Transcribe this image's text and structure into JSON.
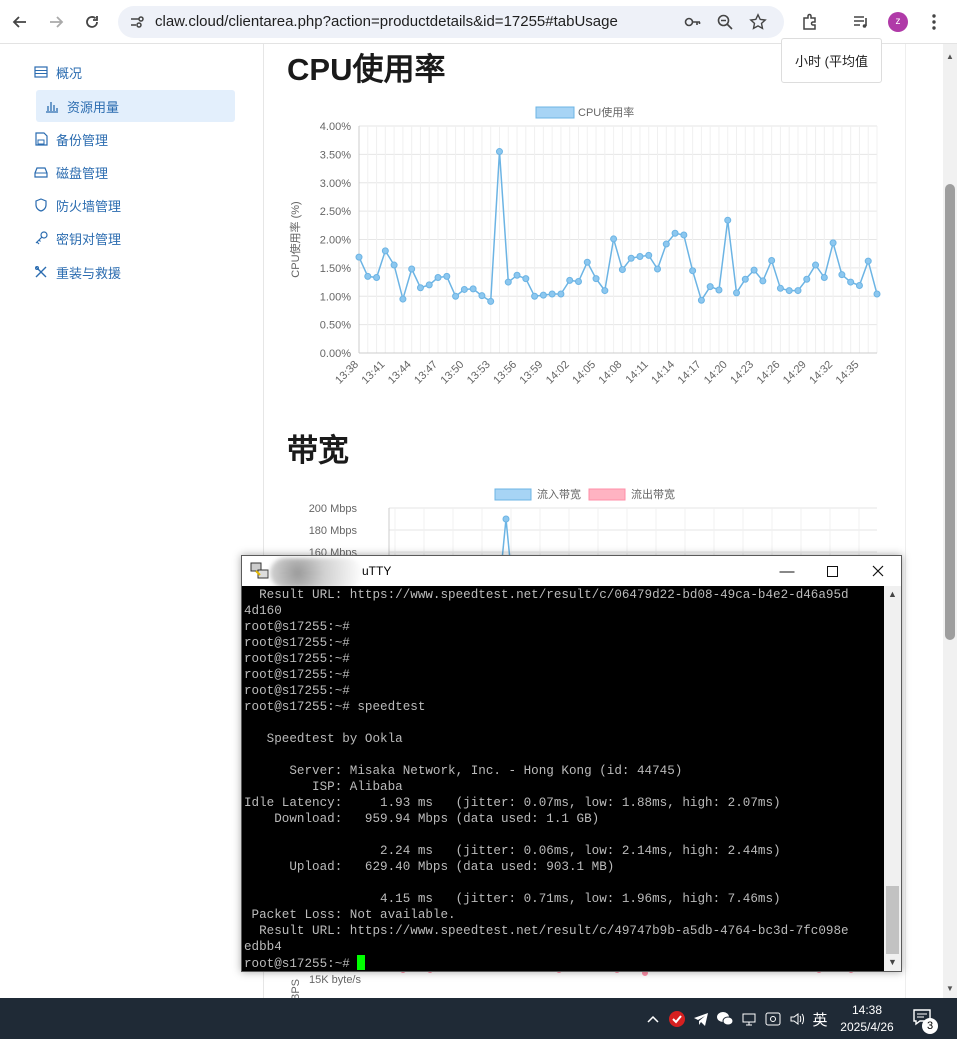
{
  "browser": {
    "url": "claw.cloud/clientarea.php?action=productdetails&id=17255#tabUsage",
    "avatar_letter": "z"
  },
  "sidebar": {
    "items": [
      {
        "label": "概况",
        "icon": "list-icon"
      },
      {
        "label": "资源用量",
        "icon": "bar-chart-icon",
        "active": true
      },
      {
        "label": "备份管理",
        "icon": "save-icon"
      },
      {
        "label": "磁盘管理",
        "icon": "disk-icon"
      },
      {
        "label": "防火墙管理",
        "icon": "shield-icon"
      },
      {
        "label": "密钥对管理",
        "icon": "key-icon"
      },
      {
        "label": "重装与救援",
        "icon": "tools-icon"
      }
    ]
  },
  "main": {
    "cpu_title": "CPU使用率",
    "period_button": "小时 (平均值",
    "bandwidth_title": "带宽"
  },
  "chart_data": [
    {
      "type": "line",
      "legend": [
        "CPU使用率"
      ],
      "ylabel": "CPU使用率 (%)",
      "ylim": [
        0,
        4
      ],
      "yticks": [
        "0.00%",
        "0.50%",
        "1.00%",
        "1.50%",
        "2.00%",
        "2.50%",
        "3.00%",
        "3.50%",
        "4.00%"
      ],
      "xtick_labels": [
        "13:38",
        "13:41",
        "13:44",
        "13:47",
        "13:50",
        "13:53",
        "13:56",
        "13:59",
        "14:02",
        "14:05",
        "14:08",
        "14:11",
        "14:14",
        "14:17",
        "14:20",
        "14:23",
        "14:26",
        "14:29",
        "14:32",
        "14:35"
      ],
      "series": [
        {
          "name": "CPU使用率",
          "color": "#6cb4e4",
          "values": [
            1.69,
            1.35,
            1.33,
            1.8,
            1.55,
            0.95,
            1.48,
            1.15,
            1.2,
            1.33,
            1.35,
            1.0,
            1.12,
            1.13,
            1.01,
            0.91,
            3.55,
            1.25,
            1.37,
            1.31,
            1.0,
            1.02,
            1.04,
            1.04,
            1.28,
            1.26,
            1.6,
            1.31,
            1.1,
            2.01,
            1.47,
            1.67,
            1.7,
            1.72,
            1.48,
            1.92,
            2.11,
            2.08,
            1.45,
            0.93,
            1.17,
            1.11,
            2.34,
            1.06,
            1.3,
            1.46,
            1.27,
            1.63,
            1.14,
            1.1,
            1.1,
            1.3,
            1.55,
            1.33,
            1.94,
            1.38,
            1.25,
            1.19,
            1.62,
            1.04
          ]
        }
      ]
    },
    {
      "type": "line",
      "legend": [
        "流入带宽",
        "流出带宽"
      ],
      "yticks": [
        "200 Mbps",
        "180 Mbps",
        "160 Mbps"
      ],
      "ylim": [
        160,
        200
      ],
      "series": [
        {
          "name": "流入带宽",
          "color": "#6cb4e4",
          "peak": 190
        },
        {
          "name": "流出带宽",
          "color": "#ff8fa8"
        }
      ],
      "second_axis_label": "15K byte/s",
      "second_axis_unit": "BPS"
    }
  ],
  "putty": {
    "title": "uTTY",
    "lines": [
      "  Result URL: https://www.speedtest.net/result/c/06479d22-bd08-49ca-b4e2-d46a95d",
      "4d160",
      "root@s17255:~#",
      "root@s17255:~#",
      "root@s17255:~#",
      "root@s17255:~#",
      "root@s17255:~#",
      "root@s17255:~# speedtest",
      "",
      "   Speedtest by Ookla",
      "",
      "      Server: Misaka Network, Inc. - Hong Kong (id: 44745)",
      "         ISP: Alibaba",
      "Idle Latency:     1.93 ms   (jitter: 0.07ms, low: 1.88ms, high: 2.07ms)",
      "    Download:   959.94 Mbps (data used: 1.1 GB)",
      "",
      "                  2.24 ms   (jitter: 0.06ms, low: 2.14ms, high: 2.44ms)",
      "      Upload:   629.40 Mbps (data used: 903.1 MB)",
      "",
      "                  4.15 ms   (jitter: 0.71ms, low: 1.96ms, high: 7.46ms)",
      " Packet Loss: Not available.",
      "  Result URL: https://www.speedtest.net/result/c/49747b9b-a5db-4764-bc3d-7fc098e",
      "edbb4",
      "root@s17255:~# "
    ]
  },
  "taskbar": {
    "ime": "英",
    "time": "14:38",
    "date": "2025/4/26",
    "notifications": "3"
  }
}
